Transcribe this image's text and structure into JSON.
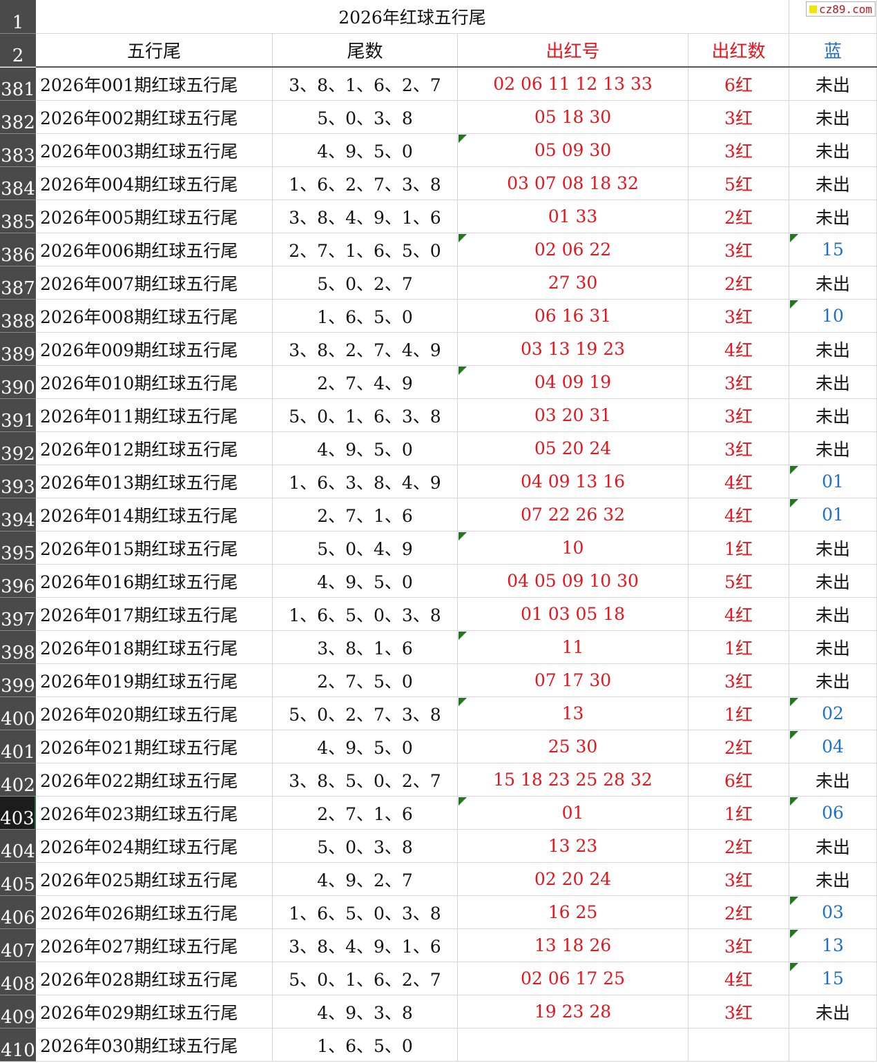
{
  "title": "2026年红球五行尾",
  "watermark": "cz89.com",
  "header_row_labels": [
    "1",
    "2"
  ],
  "columns": [
    "五行尾",
    "尾数",
    "出红号",
    "出红数",
    "蓝"
  ],
  "selected_row": "403",
  "rows": [
    {
      "row": "381",
      "name": "2026年001期红球五行尾",
      "tail": "3、8、1、6、2、7",
      "reds": "02  06  11  12  13  33",
      "count": "6红",
      "blue": "未出",
      "mark_red": false,
      "mark_blue": false
    },
    {
      "row": "382",
      "name": "2026年002期红球五行尾",
      "tail": "5、0、3、8",
      "reds": "05  18  30",
      "count": "3红",
      "blue": "未出",
      "mark_red": false,
      "mark_blue": false
    },
    {
      "row": "383",
      "name": "2026年003期红球五行尾",
      "tail": "4、9、5、0",
      "reds": "05  09  30",
      "count": "3红",
      "blue": "未出",
      "mark_red": true,
      "mark_blue": false
    },
    {
      "row": "384",
      "name": "2026年004期红球五行尾",
      "tail": "1、6、2、7、3、8",
      "reds": "03  07  08  18  32",
      "count": "5红",
      "blue": "未出",
      "mark_red": false,
      "mark_blue": false
    },
    {
      "row": "385",
      "name": "2026年005期红球五行尾",
      "tail": "3、8、4、9、1、6",
      "reds": "01  33",
      "count": "2红",
      "blue": "未出",
      "mark_red": false,
      "mark_blue": false
    },
    {
      "row": "386",
      "name": "2026年006期红球五行尾",
      "tail": "2、7、1、6、5、0",
      "reds": "02  06  22",
      "count": "3红",
      "blue": "15",
      "mark_red": true,
      "mark_blue": true
    },
    {
      "row": "387",
      "name": "2026年007期红球五行尾",
      "tail": "5、0、2、7",
      "reds": "27  30",
      "count": "2红",
      "blue": "未出",
      "mark_red": false,
      "mark_blue": false
    },
    {
      "row": "388",
      "name": "2026年008期红球五行尾",
      "tail": "1、6、5、0",
      "reds": "06  16  31",
      "count": "3红",
      "blue": "10",
      "mark_red": false,
      "mark_blue": true
    },
    {
      "row": "389",
      "name": "2026年009期红球五行尾",
      "tail": "3、8、2、7、4、9",
      "reds": "03  13  19  23",
      "count": "4红",
      "blue": "未出",
      "mark_red": false,
      "mark_blue": false
    },
    {
      "row": "390",
      "name": "2026年010期红球五行尾",
      "tail": "2、7、4、9",
      "reds": "04  09  19",
      "count": "3红",
      "blue": "未出",
      "mark_red": true,
      "mark_blue": false
    },
    {
      "row": "391",
      "name": "2026年011期红球五行尾",
      "tail": "5、0、1、6、3、8",
      "reds": "03  20  31",
      "count": "3红",
      "blue": "未出",
      "mark_red": false,
      "mark_blue": false
    },
    {
      "row": "392",
      "name": "2026年012期红球五行尾",
      "tail": "4、9、5、0",
      "reds": "05  20  24",
      "count": "3红",
      "blue": "未出",
      "mark_red": false,
      "mark_blue": false
    },
    {
      "row": "393",
      "name": "2026年013期红球五行尾",
      "tail": "1、6、3、8、4、9",
      "reds": "04  09  13  16",
      "count": "4红",
      "blue": "01",
      "mark_red": false,
      "mark_blue": true
    },
    {
      "row": "394",
      "name": "2026年014期红球五行尾",
      "tail": "2、7、1、6",
      "reds": "07  22  26  32",
      "count": "4红",
      "blue": "01",
      "mark_red": false,
      "mark_blue": true
    },
    {
      "row": "395",
      "name": "2026年015期红球五行尾",
      "tail": "5、0、4、9",
      "reds": "10",
      "count": "1红",
      "blue": "未出",
      "mark_red": true,
      "mark_blue": false
    },
    {
      "row": "396",
      "name": "2026年016期红球五行尾",
      "tail": "4、9、5、0",
      "reds": "04  05  09  10  30",
      "count": "5红",
      "blue": "未出",
      "mark_red": false,
      "mark_blue": false
    },
    {
      "row": "397",
      "name": "2026年017期红球五行尾",
      "tail": "1、6、5、0、3、8",
      "reds": "01  03  05  18",
      "count": "4红",
      "blue": "未出",
      "mark_red": false,
      "mark_blue": false
    },
    {
      "row": "398",
      "name": "2026年018期红球五行尾",
      "tail": "3、8、1、6",
      "reds": "11",
      "count": "1红",
      "blue": "未出",
      "mark_red": true,
      "mark_blue": false
    },
    {
      "row": "399",
      "name": "2026年019期红球五行尾",
      "tail": "2、7、5、0",
      "reds": "07  17  30",
      "count": "3红",
      "blue": "未出",
      "mark_red": false,
      "mark_blue": false
    },
    {
      "row": "400",
      "name": "2026年020期红球五行尾",
      "tail": "5、0、2、7、3、8",
      "reds": "13",
      "count": "1红",
      "blue": "02",
      "mark_red": true,
      "mark_blue": true
    },
    {
      "row": "401",
      "name": "2026年021期红球五行尾",
      "tail": "4、9、5、0",
      "reds": "25  30",
      "count": "2红",
      "blue": "04",
      "mark_red": false,
      "mark_blue": true
    },
    {
      "row": "402",
      "name": "2026年022期红球五行尾",
      "tail": "3、8、5、0、2、7",
      "reds": "15  18  23  25  28  32",
      "count": "6红",
      "blue": "未出",
      "mark_red": false,
      "mark_blue": false
    },
    {
      "row": "403",
      "name": "2026年023期红球五行尾",
      "tail": "2、7、1、6",
      "reds": "01",
      "count": "1红",
      "blue": "06",
      "mark_red": true,
      "mark_blue": true
    },
    {
      "row": "404",
      "name": "2026年024期红球五行尾",
      "tail": "5、0、3、8",
      "reds": "13  23",
      "count": "2红",
      "blue": "未出",
      "mark_red": false,
      "mark_blue": false
    },
    {
      "row": "405",
      "name": "2026年025期红球五行尾",
      "tail": "4、9、2、7",
      "reds": "02  20  24",
      "count": "3红",
      "blue": "未出",
      "mark_red": false,
      "mark_blue": false
    },
    {
      "row": "406",
      "name": "2026年026期红球五行尾",
      "tail": "1、6、5、0、3、8",
      "reds": "16  25",
      "count": "2红",
      "blue": "03",
      "mark_red": false,
      "mark_blue": true
    },
    {
      "row": "407",
      "name": "2026年027期红球五行尾",
      "tail": "3、8、4、9、1、6",
      "reds": "13  18  26",
      "count": "3红",
      "blue": "13",
      "mark_red": false,
      "mark_blue": true
    },
    {
      "row": "408",
      "name": "2026年028期红球五行尾",
      "tail": "5、0、1、6、2、7",
      "reds": "02  06  17  25",
      "count": "4红",
      "blue": "15",
      "mark_red": false,
      "mark_blue": true
    },
    {
      "row": "409",
      "name": "2026年029期红球五行尾",
      "tail": "4、9、3、8",
      "reds": "19  23  28",
      "count": "3红",
      "blue": "未出",
      "mark_red": false,
      "mark_blue": false
    },
    {
      "row": "410",
      "name": "2026年030期红球五行尾",
      "tail": "1、6、5、0",
      "reds": "",
      "count": "",
      "blue": "",
      "mark_red": false,
      "mark_blue": false
    }
  ],
  "colors": {
    "red": "#e8141c",
    "blue": "#1a6fd0",
    "comment_marker": "#1f7a1f",
    "row_header_bg": "#4a4a4a"
  }
}
